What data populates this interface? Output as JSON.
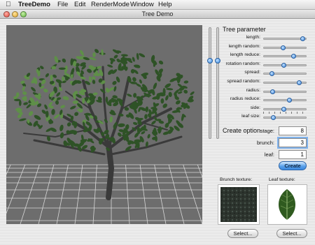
{
  "menubar": {
    "app_name": "TreeDemo",
    "items": [
      "File",
      "Edit",
      "RenderMode",
      "Window",
      "Help"
    ]
  },
  "window": {
    "title": "Tree Demo"
  },
  "tree_parameter": {
    "title": "Tree parameter",
    "sliders": [
      {
        "label": "length:",
        "value": 0.97
      },
      {
        "label": "length random:",
        "value": 0.45
      },
      {
        "label": "length reduce:",
        "value": 0.72
      },
      {
        "label": "rotation random:",
        "value": 0.48
      },
      {
        "label": "spread:",
        "value": 0.16
      },
      {
        "label": "spread random:",
        "value": 0.88
      },
      {
        "label": "radius:",
        "value": 0.18
      },
      {
        "label": "radius reduce:",
        "value": 0.62
      },
      {
        "label": "side:",
        "value": 0.47
      },
      {
        "label": "leaf size:",
        "value": 0.2
      }
    ],
    "vertical_sliders": [
      0.55,
      0.55
    ]
  },
  "create_option": {
    "title": "Create option",
    "stage_label": "stage:",
    "stage_value": "8",
    "brunch_label": "brunch:",
    "brunch_value": "3",
    "leaf_label": "leaf:",
    "leaf_value": "1",
    "create_button": "Create"
  },
  "textures": {
    "brunch_label": "Brunch texture:",
    "leaf_label": "Leaf texture:",
    "select_button": "Select..."
  },
  "colors": {
    "viewport_bg": "#6d6d6d",
    "grid": "#d8d8d8",
    "leaf_dark": "#2e5226",
    "leaf_light": "#5e8f48",
    "accent": "#3d86dd"
  }
}
